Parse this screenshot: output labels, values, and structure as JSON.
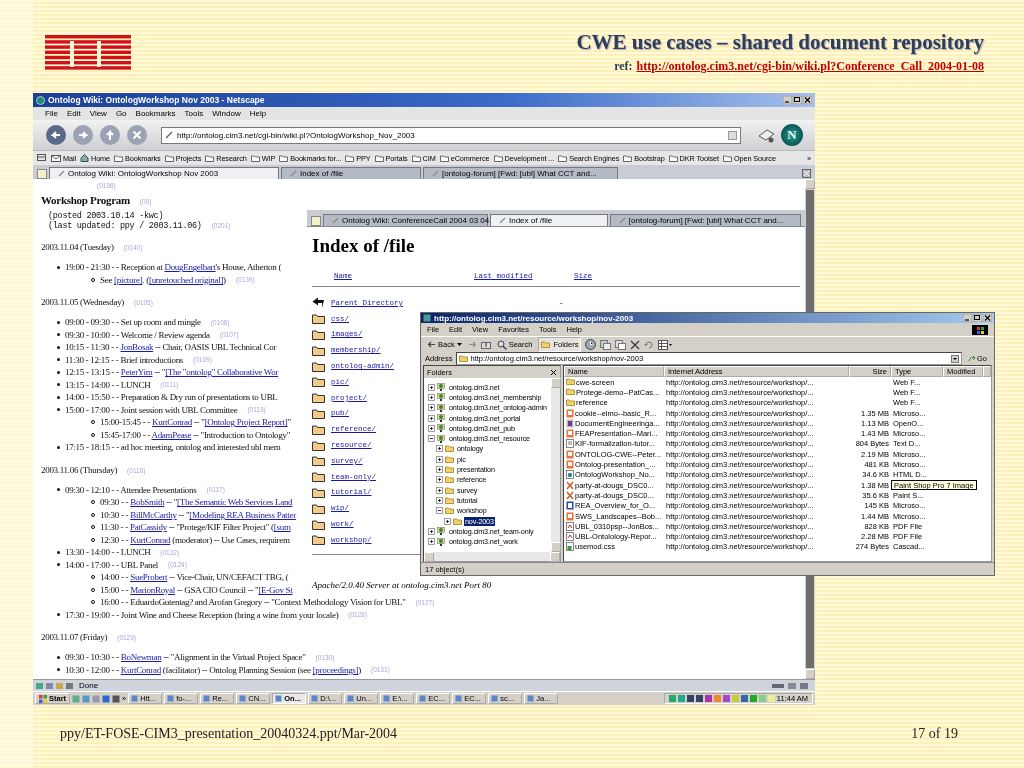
{
  "slide": {
    "title": "CWE use cases – shared document repository",
    "ref_label": "ref:",
    "ref_link": "http://ontolog.cim3.net/cgi-bin/wiki.pl?Conference_Call_2004-01-08",
    "footer": "ppy/ET-FOSE-CIM3_presentation_20040324.ppt/Mar-2004",
    "page": "17 of  19"
  },
  "browser": {
    "title": "Ontolog Wiki: OntologWorkshop Nov 2003 - Netscape",
    "menu": [
      "File",
      "Edit",
      "View",
      "Go",
      "Bookmarks",
      "Tools",
      "Window",
      "Help"
    ],
    "address": "http://ontolog.cim3.net/cgi-bin/wiki.pl?OntologWorkshop_Nov_2003",
    "logo": "N",
    "bookmarks": [
      {
        "label": "Mail",
        "kind": "mail"
      },
      {
        "label": "Home",
        "kind": "home"
      },
      {
        "label": "Bookmarks",
        "kind": "folder"
      },
      {
        "label": "Projects",
        "kind": "folder"
      },
      {
        "label": "Research",
        "kind": "folder"
      },
      {
        "label": "WIP",
        "kind": "folder"
      },
      {
        "label": "Bookmarks for...",
        "kind": "folder"
      },
      {
        "label": "PPY",
        "kind": "folder"
      },
      {
        "label": "Portals",
        "kind": "folder"
      },
      {
        "label": "CIM",
        "kind": "folder"
      },
      {
        "label": "eCommerce",
        "kind": "folder"
      },
      {
        "label": "Development ...",
        "kind": "folder"
      },
      {
        "label": "Search Engines",
        "kind": "folder"
      },
      {
        "label": "Bootstrap",
        "kind": "folder"
      },
      {
        "label": "DKR Toolset",
        "kind": "folder"
      },
      {
        "label": "Open Source",
        "kind": "folder"
      },
      {
        "label": "»",
        "kind": "more"
      }
    ],
    "tabs": [
      {
        "label": "Ontolog Wiki: OntologWorkshop Nov 2003",
        "selected": true
      },
      {
        "label": "Index of /file",
        "selected": false
      },
      {
        "label": "[ontolog-forum] [Fwd: [ubl] What CCT and...",
        "selected": false
      }
    ],
    "status": "Done",
    "wiki": {
      "top_mark": "(0198)",
      "heading": "Workshop Program",
      "heading_mark": "(09)",
      "posted": [
        {
          "text": "(posted 2003.10.14 -kwc)"
        },
        {
          "text": "(last updated: ppy / 2003.11.06)",
          "mark": "(0201)"
        }
      ],
      "days": [
        {
          "date": "2003.11.04 (Tuesday)",
          "mark": "(0140)",
          "items": [
            {
              "parts": [
                {
                  "text": "19:00 - 21:30 - - Reception at ",
                  "kind": "plain"
                },
                {
                  "text": "DougEngelbart",
                  "kind": "link"
                },
                {
                  "text": "'s House, Atherton (",
                  "kind": "plain"
                }
              ],
              "children": [
                {
                  "parts": [
                    {
                      "text": "See ",
                      "kind": "plain"
                    },
                    {
                      "text": "[picture]",
                      "kind": "link"
                    },
                    {
                      "text": ". (",
                      "kind": "plain"
                    },
                    {
                      "text": "[unretouched original]",
                      "kind": "link"
                    },
                    {
                      "text": ")",
                      "kind": "plain"
                    }
                  ],
                  "mark": "(0139)"
                }
              ]
            }
          ]
        },
        {
          "date": "2003.11.05 (Wednesday)",
          "mark": "(0105)",
          "items": [
            {
              "parts": [
                {
                  "text": "09:00 - 09:30 - - Set up room and mingle",
                  "kind": "plain"
                }
              ],
              "mark": "(0106)"
            },
            {
              "parts": [
                {
                  "text": "09:30 - 10:00 - - Welcome / Review agenda",
                  "kind": "plain"
                }
              ],
              "mark": "(0107)"
            },
            {
              "parts": [
                {
                  "text": "10:15 - 11:30 - - ",
                  "kind": "plain"
                },
                {
                  "text": "JonBosak",
                  "kind": "link"
                },
                {
                  "text": " -- Chair, OASIS UBL Technical Cor",
                  "kind": "plain"
                }
              ]
            },
            {
              "parts": [
                {
                  "text": "11:30 - 12:15 - - Brief introductions",
                  "kind": "plain"
                }
              ],
              "mark": "(0109)"
            },
            {
              "parts": [
                {
                  "text": "12:15 - 13:15 - - ",
                  "kind": "plain"
                },
                {
                  "text": "PeterYim",
                  "kind": "link"
                },
                {
                  "text": " -- \"",
                  "kind": "plain"
                },
                {
                  "text": "[The \"ontolog\" Collaborative Wor",
                  "kind": "link"
                }
              ]
            },
            {
              "parts": [
                {
                  "text": "13:15 - 14:00 - - LUNCH",
                  "kind": "plain"
                }
              ],
              "mark": "(0111)"
            },
            {
              "parts": [
                {
                  "text": "14:00 - 15:50 - - Preparation & Dry run of presentations to UBL",
                  "kind": "plain"
                }
              ]
            },
            {
              "parts": [
                {
                  "text": "15:00 - 17:00 - - Joint session with UBL Committee",
                  "kind": "plain"
                }
              ],
              "mark": "(0113)",
              "children": [
                {
                  "parts": [
                    {
                      "text": "15:00-15:45 - - ",
                      "kind": "plain"
                    },
                    {
                      "text": "KurtConrad",
                      "kind": "link"
                    },
                    {
                      "text": " -- \"",
                      "kind": "plain"
                    },
                    {
                      "text": "[Ontolog Project Report]",
                      "kind": "link"
                    },
                    {
                      "text": "\"",
                      "kind": "plain"
                    }
                  ]
                },
                {
                  "parts": [
                    {
                      "text": "15:45-17:00 - - ",
                      "kind": "plain"
                    },
                    {
                      "text": "AdamPease",
                      "kind": "link"
                    },
                    {
                      "text": " -- \"Introduction to Ontology\"",
                      "kind": "plain"
                    }
                  ]
                }
              ]
            },
            {
              "parts": [
                {
                  "text": "17:15 - 18:15 - - ad hoc meeting, ontolog and interested ubl mem",
                  "kind": "plain"
                }
              ]
            }
          ]
        },
        {
          "date": "2003.11.06 (Thursday)",
          "mark": "(0116)",
          "items": [
            {
              "parts": [
                {
                  "text": "09:30 - 12:10 - - Attendee Presentations",
                  "kind": "plain"
                }
              ],
              "mark": "(0117)",
              "children": [
                {
                  "parts": [
                    {
                      "text": "09:30 - - ",
                      "kind": "plain"
                    },
                    {
                      "text": "BobSmith",
                      "kind": "link"
                    },
                    {
                      "text": " -- \"",
                      "kind": "plain"
                    },
                    {
                      "text": "[The Semantic Web Services Land",
                      "kind": "link"
                    }
                  ]
                },
                {
                  "parts": [
                    {
                      "text": "10:30 - - ",
                      "kind": "plain"
                    },
                    {
                      "text": "BillMcCarthy",
                      "kind": "link"
                    },
                    {
                      "text": " -- \"",
                      "kind": "plain"
                    },
                    {
                      "text": "[Modeling REA Business Patter",
                      "kind": "link"
                    }
                  ]
                },
                {
                  "parts": [
                    {
                      "text": "11:30 - - ",
                      "kind": "plain"
                    },
                    {
                      "text": "PatCassidy",
                      "kind": "link"
                    },
                    {
                      "text": " -- \"Protege/KIF Filter Project\" (",
                      "kind": "plain"
                    },
                    {
                      "text": "[sum",
                      "kind": "link"
                    }
                  ]
                },
                {
                  "parts": [
                    {
                      "text": "12:30 - - ",
                      "kind": "plain"
                    },
                    {
                      "text": "KurtConrad",
                      "kind": "link"
                    },
                    {
                      "text": " (moderator) -- Use Cases, requirem",
                      "kind": "plain"
                    }
                  ]
                }
              ]
            },
            {
              "parts": [
                {
                  "text": "13:30 - 14:00 - - LUNCH",
                  "kind": "plain"
                }
              ],
              "mark": "(0122)"
            },
            {
              "parts": [
                {
                  "text": "14:00 - 17:00 - - UBL Panel",
                  "kind": "plain"
                }
              ],
              "mark": "(0124)",
              "children": [
                {
                  "parts": [
                    {
                      "text": "14:00 - - ",
                      "kind": "plain"
                    },
                    {
                      "text": "SueProbert",
                      "kind": "link"
                    },
                    {
                      "text": " -- Vice-Chair, UN/CEFACT TBG, (",
                      "kind": "plain"
                    }
                  ]
                },
                {
                  "parts": [
                    {
                      "text": "15:00 - - ",
                      "kind": "plain"
                    },
                    {
                      "text": "MarionRoyal",
                      "kind": "link"
                    },
                    {
                      "text": " -- GSA CIO Council -- \"",
                      "kind": "plain"
                    },
                    {
                      "text": "[E-Gov St",
                      "kind": "link"
                    }
                  ]
                },
                {
                  "parts": [
                    {
                      "text": "16:00 - - EduardoGutentag? and Arofan Gregory -- \"Context Methodology Vision for UBL\"",
                      "kind": "plain"
                    }
                  ],
                  "mark": "(0127)"
                }
              ]
            },
            {
              "parts": [
                {
                  "text": "17:30 - 19:00 - - Joint Wine and Cheese Reception (bring a wine from your locale)",
                  "kind": "plain"
                }
              ],
              "mark": "(0128)"
            }
          ]
        },
        {
          "date": "2003.11.07 (Friday)",
          "mark": "(0129)",
          "items": [
            {
              "parts": [
                {
                  "text": "09:30 - 10:30 - - ",
                  "kind": "plain"
                },
                {
                  "text": "BoNewman",
                  "kind": "link"
                },
                {
                  "text": " -- \"Alignment in the Virtual Project Space\"",
                  "kind": "plain"
                }
              ],
              "mark": "(0130)"
            },
            {
              "parts": [
                {
                  "text": "10:30 - 12:00 - - ",
                  "kind": "plain"
                },
                {
                  "text": "KurtConrad",
                  "kind": "link"
                },
                {
                  "text": " (facilitator) -- Ontolog Planning Session (see ",
                  "kind": "plain"
                },
                {
                  "text": "[proceedings]",
                  "kind": "link"
                },
                {
                  "text": ")",
                  "kind": "plain"
                }
              ],
              "mark": "(0131)"
            }
          ]
        }
      ]
    }
  },
  "index_page": {
    "tabs": [
      {
        "label": "Ontolog Wiki: ConferenceCall 2004 03 04",
        "selected": false
      },
      {
        "label": "Index of /file",
        "selected": true
      },
      {
        "label": "[ontolog-forum] [Fwd: [ubl] What CCT and...",
        "selected": false
      }
    ],
    "heading": "Index of /file",
    "columns": [
      "Name",
      "Last modified",
      "Size"
    ],
    "entries": [
      {
        "name": "Parent Directory",
        "kind": "parent",
        "size": "-"
      },
      {
        "name": "css/",
        "kind": "folder"
      },
      {
        "name": "images/",
        "kind": "folder"
      },
      {
        "name": "membership/",
        "kind": "folder"
      },
      {
        "name": "ontolog-admin/",
        "kind": "folder"
      },
      {
        "name": "pic/",
        "kind": "folder"
      },
      {
        "name": "project/",
        "kind": "folder"
      },
      {
        "name": "pub/",
        "kind": "folder"
      },
      {
        "name": "reference/",
        "kind": "folder"
      },
      {
        "name": "resource/",
        "kind": "folder"
      },
      {
        "name": "survey/",
        "kind": "folder"
      },
      {
        "name": "team-only/",
        "kind": "folder"
      },
      {
        "name": "tutorial/",
        "kind": "folder"
      },
      {
        "name": "wip/",
        "kind": "folder"
      },
      {
        "name": "work/",
        "kind": "folder"
      },
      {
        "name": "workshop/",
        "kind": "folder"
      }
    ],
    "footer": "Apache/2.0.40 Server at ontolog.cim3.net Port 80"
  },
  "explorer": {
    "title": "http://ontolog.cim3.net/resource/workshop/nov-2003",
    "menu": [
      "File",
      "Edit",
      "View",
      "Favorites",
      "Tools",
      "Help"
    ],
    "toolbar": {
      "back": "Back",
      "search": "Search",
      "folders": "Folders"
    },
    "address_label": "Address",
    "address": "http://ontolog.cim3.net/resource/workshop/nov-2003",
    "go": "Go",
    "folders_title": "Folders",
    "tree": [
      {
        "label": "ontolog.cim3.net",
        "kind": "site",
        "expanded": false,
        "selected": false
      },
      {
        "label": "ontolog.cim3.net_membership",
        "kind": "site",
        "expanded": false,
        "selected": false
      },
      {
        "label": "ontolog.cim3.net_ontolog-admin",
        "kind": "site",
        "expanded": false,
        "selected": false
      },
      {
        "label": "ontolog.cim3.net_portal",
        "kind": "site",
        "expanded": false,
        "selected": false
      },
      {
        "label": "ontolog.cim3.net_pub",
        "kind": "site",
        "expanded": false,
        "selected": false
      },
      {
        "label": "ontolog.cim3.net_resource",
        "kind": "site",
        "expanded": true,
        "selected": false,
        "children": [
          {
            "label": "ontology",
            "kind": "folder",
            "expanded": false,
            "selected": false
          },
          {
            "label": "pic",
            "kind": "folder",
            "expanded": false,
            "selected": false
          },
          {
            "label": "presentation",
            "kind": "folder",
            "expanded": false,
            "selected": false
          },
          {
            "label": "reference",
            "kind": "folder",
            "expanded": false,
            "selected": false
          },
          {
            "label": "survey",
            "kind": "folder",
            "expanded": false,
            "selected": false
          },
          {
            "label": "tutorial",
            "kind": "folder",
            "expanded": false,
            "selected": false
          },
          {
            "label": "workshop",
            "kind": "folder",
            "expanded": true,
            "selected": false,
            "children": [
              {
                "label": "nov-2003",
                "kind": "folder",
                "expanded": false,
                "selected": true
              }
            ]
          }
        ]
      },
      {
        "label": "ontolog.cim3.net_team-only",
        "kind": "site",
        "expanded": false,
        "selected": false
      },
      {
        "label": "ontolog.cim3.net_work",
        "kind": "site",
        "expanded": false,
        "selected": false
      }
    ],
    "columns": [
      "Name",
      "Internet Address",
      "Size",
      "Type",
      "Modified"
    ],
    "files": [
      {
        "name": "cwe-screen",
        "address": "http://ontolog.cim3.net/resource/workshop/...",
        "type": "Web F...",
        "kind": "folder"
      },
      {
        "name": "Protege-demo--PatCas...",
        "address": "http://ontolog.cim3.net/resource/workshop/...",
        "type": "Web F...",
        "kind": "folder"
      },
      {
        "name": "reference",
        "address": "http://ontolog.cim3.net/resource/workshop/...",
        "type": "Web F...",
        "kind": "folder"
      },
      {
        "name": "cookie--elmo--basic_R...",
        "address": "http://ontolog.cim3.net/resource/workshop/...",
        "size": "1.35 MB",
        "type": "Microso...",
        "kind": "slides"
      },
      {
        "name": "DocumentEngineeringa...",
        "address": "http://ontolog.cim3.net/resource/workshop/...",
        "size": "1.13 MB",
        "type": "OpenO...",
        "kind": "office"
      },
      {
        "name": "FEAPresentation--Mari...",
        "address": "http://ontolog.cim3.net/resource/workshop/...",
        "size": "1.43 MB",
        "type": "Microso...",
        "kind": "slides"
      },
      {
        "name": "KIF-formalization-tutor...",
        "address": "http://ontolog.cim3.net/resource/workshop/...",
        "size": "804 Bytes",
        "type": "Text D...",
        "kind": "text"
      },
      {
        "name": "ONTOLOG-CWE--Peter...",
        "address": "http://ontolog.cim3.net/resource/workshop/...",
        "size": "2.19 MB",
        "type": "Microso...",
        "kind": "slides"
      },
      {
        "name": "Ontolog-presentation_...",
        "address": "http://ontolog.cim3.net/resource/workshop/...",
        "size": "481 KB",
        "type": "Microso...",
        "kind": "slides"
      },
      {
        "name": "OntologWorkshop_No...",
        "address": "http://ontolog.cim3.net/resource/workshop/...",
        "size": "34.6 KB",
        "type": "HTML D...",
        "kind": "html"
      },
      {
        "name": "party-at-dougs_DSC0...",
        "address": "http://ontolog.cim3.net/resource/workshop/...",
        "size": "1.38 MB",
        "tooltip": "Paint Shop Pro 7 Image",
        "kind": "image"
      },
      {
        "name": "party-at-dougs_DSC0...",
        "address": "http://ontolog.cim3.net/resource/workshop/...",
        "size": "35.6 KB",
        "type": "Paint S...",
        "kind": "image"
      },
      {
        "name": "REA_Overview_for_O...",
        "address": "http://ontolog.cim3.net/resource/workshop/...",
        "size": "145 KB",
        "type": "Microso...",
        "kind": "word"
      },
      {
        "name": "SWS_Landscapes--Bob...",
        "address": "http://ontolog.cim3.net/resource/workshop/...",
        "size": "1.44 MB",
        "type": "Microso...",
        "kind": "slides"
      },
      {
        "name": "UBL_0310psp--JonBos...",
        "address": "http://ontolog.cim3.net/resource/workshop/...",
        "size": "828 KB",
        "type": "PDF File",
        "kind": "pdf"
      },
      {
        "name": "UBL-Ontolology-Repor...",
        "address": "http://ontolog.cim3.net/resource/workshop/...",
        "size": "2.28 MB",
        "type": "PDF File",
        "kind": "pdf"
      },
      {
        "name": "usemod.css",
        "address": "http://ontolog.cim3.net/resource/workshop/...",
        "size": "274 Bytes",
        "type": "Cascad...",
        "kind": "css"
      }
    ],
    "status": "17 object(s)"
  },
  "taskbar": {
    "start": "Start",
    "more": "»",
    "tasks": [
      {
        "label": "Htt...",
        "selected": false
      },
      {
        "label": "fo-...",
        "selected": false
      },
      {
        "label": "Re...",
        "selected": false
      },
      {
        "label": "CN...",
        "selected": false
      },
      {
        "label": "On...",
        "selected": true
      },
      {
        "label": "D:\\...",
        "selected": false
      },
      {
        "label": "Un...",
        "selected": false
      },
      {
        "label": "E:\\...",
        "selected": false
      },
      {
        "label": "EC...",
        "selected": false
      },
      {
        "label": "EC...",
        "selected": false
      },
      {
        "label": "sc...",
        "selected": false
      },
      {
        "label": "Ja...",
        "selected": false
      }
    ],
    "clock": "11:44 AM"
  }
}
